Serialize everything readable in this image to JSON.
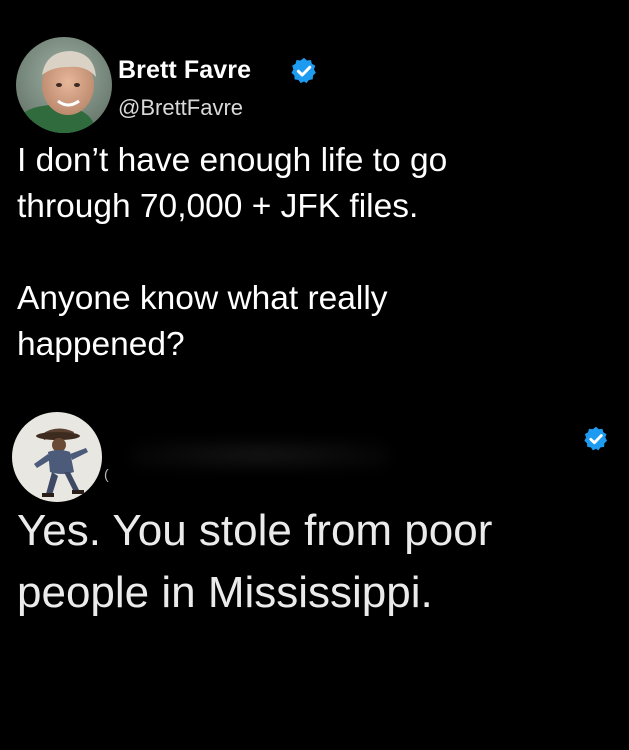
{
  "colors": {
    "background": "#000000",
    "text_primary": "#ffffff",
    "text_secondary": "#d9d9d9",
    "verified_badge": "#1d9bf0"
  },
  "original_tweet": {
    "author": {
      "display_name": "Brett Favre",
      "handle": "@BrettFavre",
      "verified": true,
      "avatar_icon": "profile-photo-avatar"
    },
    "text_lines": [
      "I don’t have enough life to go",
      "through 70,000 + JFK files.",
      "",
      "Anyone know what really",
      "happened?"
    ]
  },
  "reply_tweet": {
    "author": {
      "display_name": "",
      "handle_fragment": "(",
      "verified": true,
      "avatar_icon": "cowboy-figure-avatar"
    },
    "text_lines": [
      "Yes. You stole from poor",
      "people in Mississippi."
    ]
  }
}
